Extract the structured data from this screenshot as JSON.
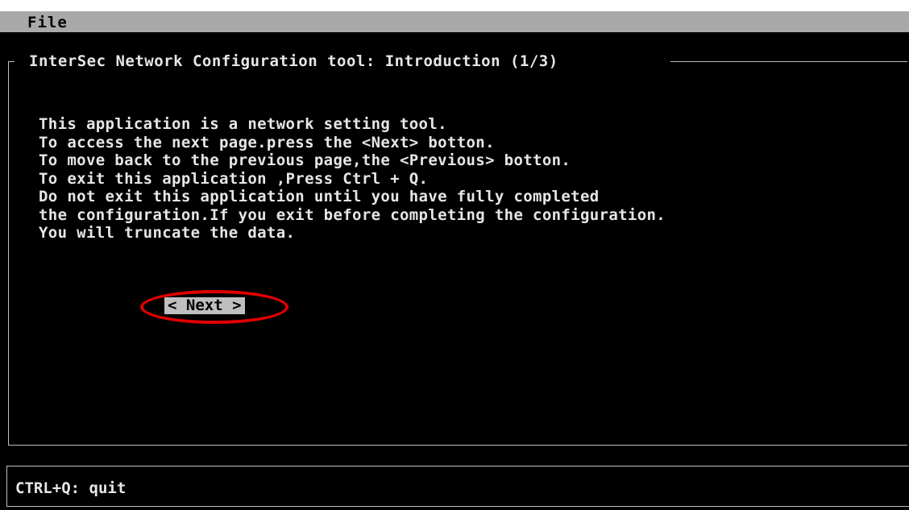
{
  "menu": {
    "file_label": "File"
  },
  "dialog": {
    "title": "InterSec Network Configuration tool: Introduction (1/3)",
    "lines": [
      "This application is a network setting tool.",
      "To access the next page.press the <Next> botton.",
      "To move back to the previous page,the <Previous> botton.",
      "To exit this application ,Press Ctrl + Q.",
      "Do not exit this application until you have fully completed",
      "the configuration.If you exit before completing the configuration.",
      "You will truncate the data."
    ],
    "next_button_label": "< Next >"
  },
  "status_bar": {
    "text": "CTRL+Q: quit"
  },
  "colors": {
    "background": "#000000",
    "text": "#e6e6e6",
    "menubar": "#a9a9a9",
    "button_bg": "#bfbfbf",
    "highlight_ring": "#e10000"
  }
}
